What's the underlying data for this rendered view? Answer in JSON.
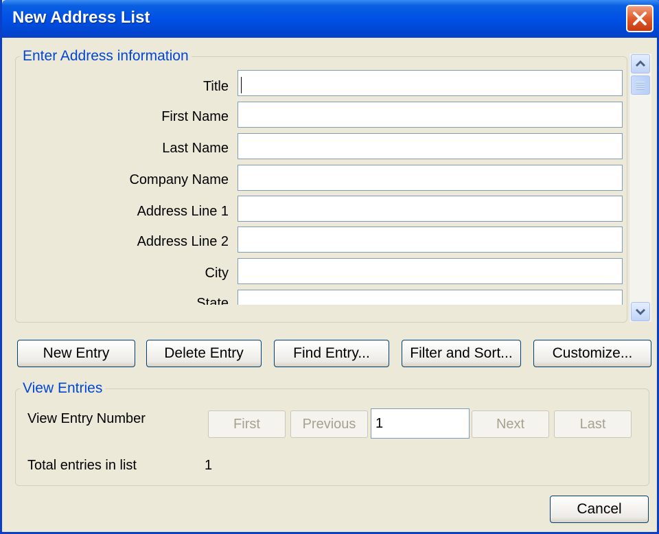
{
  "window": {
    "title": "New Address List"
  },
  "address_group": {
    "label": "Enter Address information",
    "fields": [
      {
        "label": "Title",
        "value": ""
      },
      {
        "label": "First Name",
        "value": ""
      },
      {
        "label": "Last Name",
        "value": ""
      },
      {
        "label": "Company Name",
        "value": ""
      },
      {
        "label": "Address Line 1",
        "value": ""
      },
      {
        "label": "Address Line 2",
        "value": ""
      },
      {
        "label": "City",
        "value": ""
      },
      {
        "label": "State",
        "value": ""
      }
    ]
  },
  "actions": {
    "new_entry": "New Entry",
    "delete_entry": "Delete Entry",
    "find_entry": "Find Entry...",
    "filter_sort": "Filter and Sort...",
    "customize": "Customize..."
  },
  "view_group": {
    "label": "View Entries",
    "entry_number_label": "View Entry Number",
    "first": "First",
    "previous": "Previous",
    "entry_number_value": "1",
    "next": "Next",
    "last": "Last",
    "total_label": "Total entries in list",
    "total_value": "1"
  },
  "footer": {
    "cancel": "Cancel"
  },
  "icons": [
    "close-icon",
    "scroll-up-icon",
    "scroll-down-icon"
  ]
}
